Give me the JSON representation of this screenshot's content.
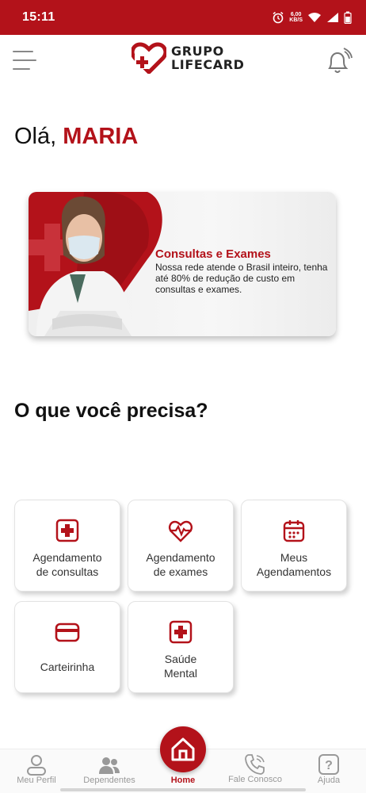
{
  "status_bar": {
    "time": "15:11",
    "net_speed_value": "6,00",
    "net_speed_unit": "KB/S",
    "icons": [
      "alarm-icon",
      "wifi-icon",
      "signal-icon",
      "battery-icon"
    ],
    "color": "#b3121a"
  },
  "header": {
    "logo_line1": "GRUPO",
    "logo_line2": "LIFECARD",
    "menu_icon": "hamburger-icon",
    "notification_icon": "bell-icon"
  },
  "greeting": {
    "prefix": "Olá,",
    "name": "MARIA"
  },
  "banner": {
    "title": "Consultas e Exames",
    "text": "Nossa rede atende o Brasil inteiro, tenha até 80% de redução de custo em consultas e exames."
  },
  "section_title": "O que você precisa?",
  "services": [
    {
      "label_line1": "Agendamento",
      "label_line2": "de consultas",
      "icon": "medical-cross-icon"
    },
    {
      "label_line1": "Agendamento",
      "label_line2": "de exames",
      "icon": "heart-pulse-icon"
    },
    {
      "label_line1": "Meus",
      "label_line2": "Agendamentos",
      "icon": "calendar-icon"
    },
    {
      "label_line1": "Carteirinha",
      "label_line2": "",
      "icon": "card-icon"
    },
    {
      "label_line1": "Saúde",
      "label_line2": "Mental",
      "icon": "medical-cross-icon"
    }
  ],
  "bottom_nav": {
    "items": [
      {
        "label": "Meu Perfil",
        "icon": "user-icon"
      },
      {
        "label": "Dependentes",
        "icon": "users-icon"
      },
      {
        "label": "Home",
        "icon": "home-icon",
        "active": true
      },
      {
        "label": "Fale Conosco",
        "icon": "phone-icon"
      },
      {
        "label": "Ajuda",
        "icon": "help-icon"
      }
    ]
  },
  "colors": {
    "brand": "#b3121a",
    "text": "#111111",
    "muted": "#999999"
  }
}
